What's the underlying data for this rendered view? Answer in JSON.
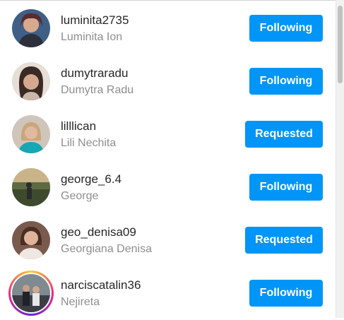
{
  "users": [
    {
      "username": "luminita2735",
      "fullname": "Luminita Ion",
      "button": "Following",
      "avatar_color": "#5a4a6e"
    },
    {
      "username": "dumytraradu",
      "fullname": "Dumytra Radu",
      "button": "Following",
      "avatar_color": "#8a6a58"
    },
    {
      "username": "lilllican",
      "fullname": "Lili Nechita",
      "button": "Requested",
      "avatar_color": "#b79a7a"
    },
    {
      "username": "george_6.4",
      "fullname": "George",
      "button": "Following",
      "avatar_color": "#5d6a43"
    },
    {
      "username": "geo_denisa09",
      "fullname": "Georgiana Denisa",
      "button": "Requested",
      "avatar_color": "#6f4a3e"
    },
    {
      "username": "narciscatalin36",
      "fullname": "Nejireta",
      "button": "Following",
      "avatar_color": "#4b4f55",
      "story_ring": true
    }
  ],
  "colors": {
    "button": "#0095f6",
    "username": "#262626",
    "fullname": "#8e8e8e"
  }
}
